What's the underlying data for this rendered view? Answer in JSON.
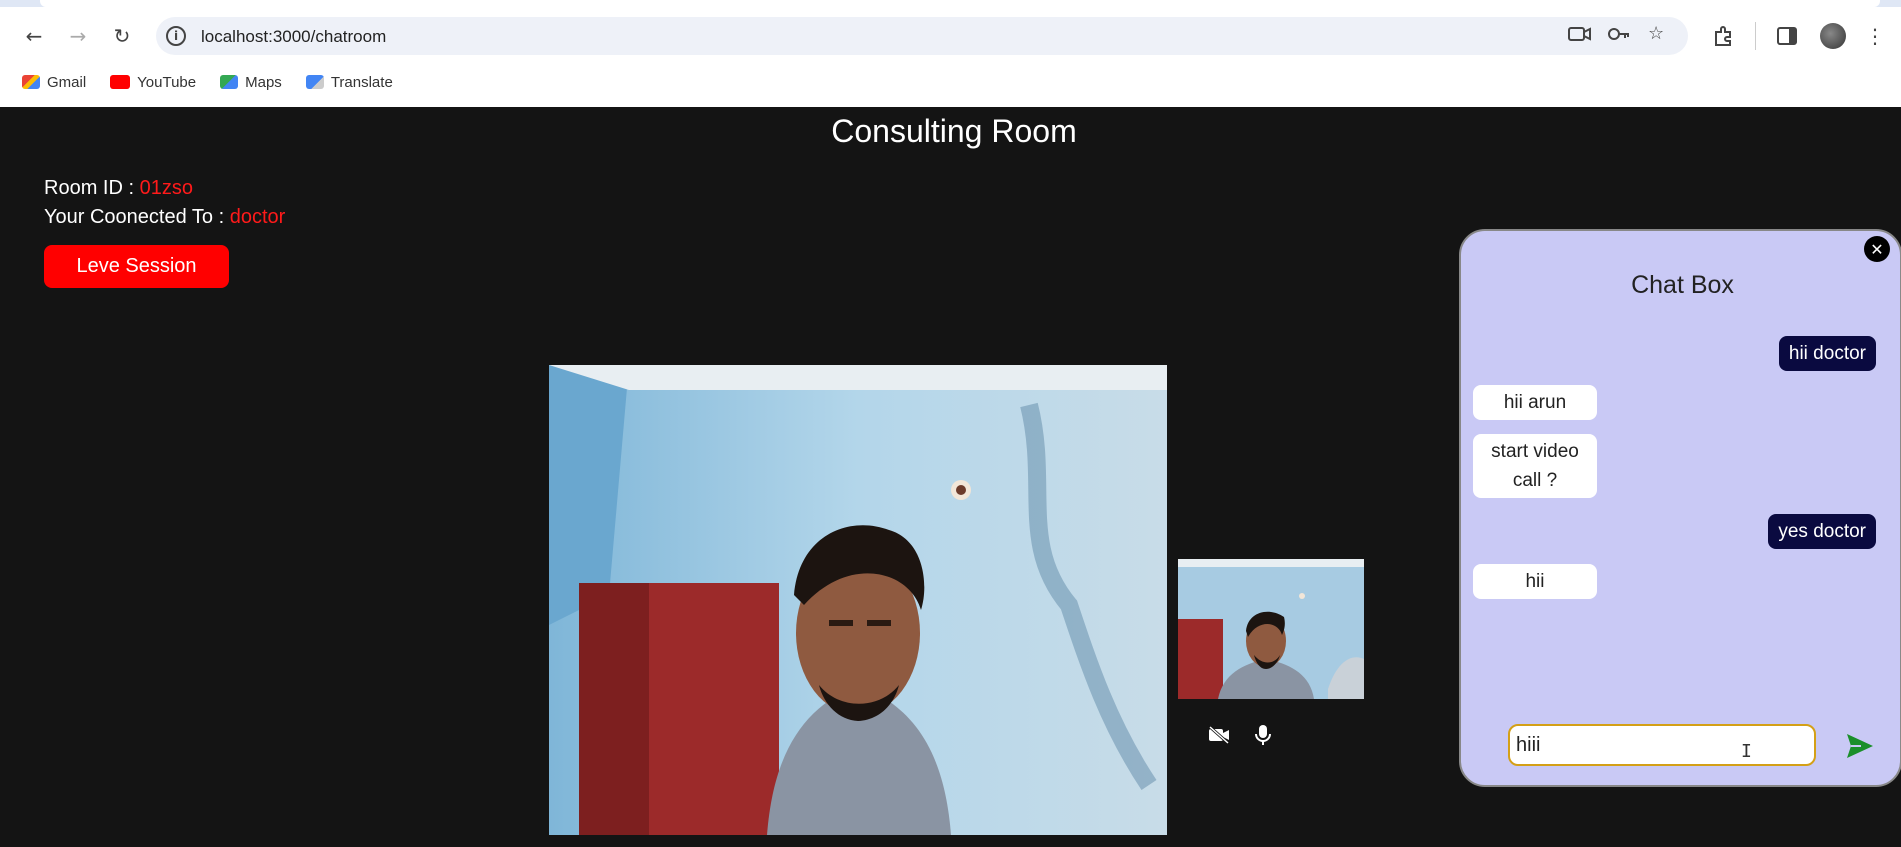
{
  "browser": {
    "url": "localhost:3000/chatroom",
    "bookmarks": [
      {
        "label": "Gmail",
        "color": "#ea4335"
      },
      {
        "label": "YouTube",
        "color": "#ff0000"
      },
      {
        "label": "Maps",
        "color": "#34a853"
      },
      {
        "label": "Translate",
        "color": "#4285f4"
      }
    ]
  },
  "room": {
    "title": "Consulting Room",
    "room_id_label": "Room ID : ",
    "room_id": "01zso",
    "connected_label": "Your Coonected To : ",
    "connected_to": "doctor",
    "leave_label": "Leve Session"
  },
  "chat": {
    "title": "Chat Box",
    "close_icon": "close-icon",
    "messages": [
      {
        "direction": "out",
        "text": "hii doctor"
      },
      {
        "direction": "in",
        "text": "hii arun"
      },
      {
        "direction": "in",
        "text": "start video call ?"
      },
      {
        "direction": "out",
        "text": "yes doctor"
      },
      {
        "direction": "in",
        "text": "hii"
      }
    ],
    "input_value": "hiii",
    "send_icon": "send-icon"
  },
  "controls": {
    "camera_icon": "camera-off-icon",
    "mic_icon": "microphone-icon"
  },
  "colors": {
    "accent_red": "#ff0000",
    "chat_bg": "#c9c9f5",
    "outgoing_bubble": "#0a0a40",
    "send_green": "#1a8f2a"
  }
}
